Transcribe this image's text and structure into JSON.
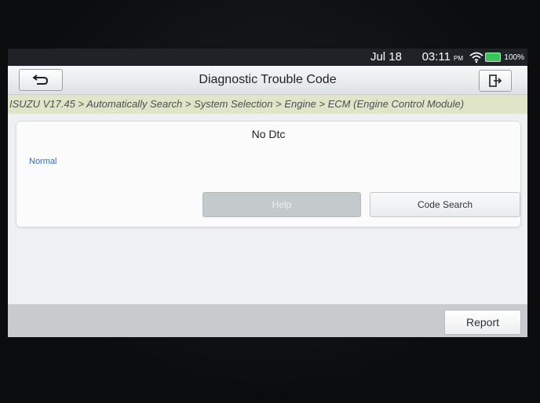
{
  "status_bar": {
    "date": "Jul 18",
    "time": "03:11",
    "ampm": "PM",
    "battery": "100%",
    "icons": [
      "wifi-icon",
      "battery-icon"
    ]
  },
  "header": {
    "title": "Diagnostic Trouble Code",
    "back_icon": "back-arrow-icon",
    "exit_icon": "exit-icon"
  },
  "breadcrumb": "ISUZU V17.45 > Automatically Search > System Selection > Engine > ECM (Engine Control Module)",
  "dtc_panel": {
    "message": "No Dtc",
    "status": "Normal",
    "help_label": "Help",
    "code_search_label": "Code Search"
  },
  "footer": {
    "report_label": "Report"
  },
  "colors": {
    "status_text": "#2e6fd6",
    "breadcrumb_bg": "#e0e5c8",
    "battery": "#34c759"
  }
}
